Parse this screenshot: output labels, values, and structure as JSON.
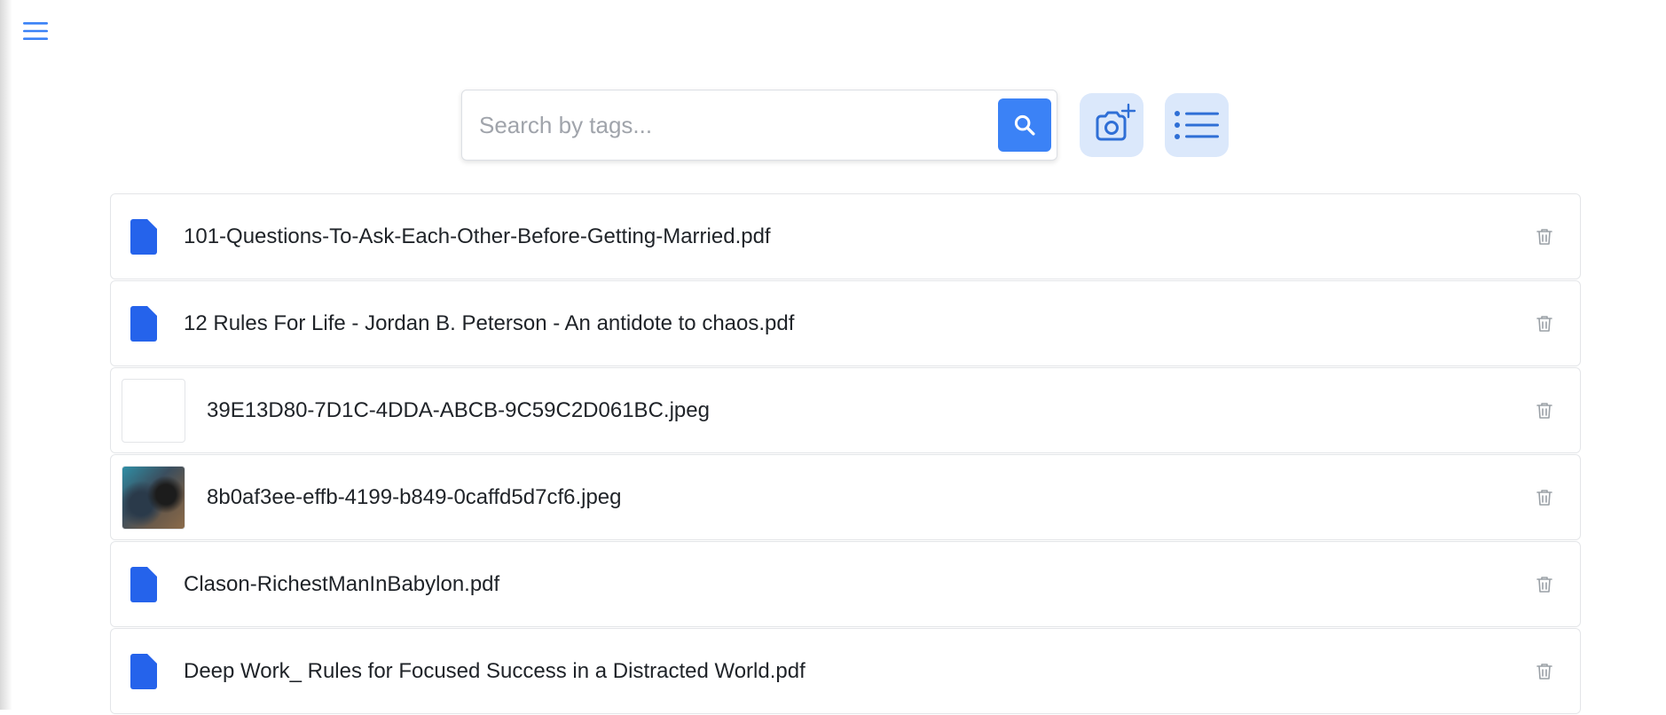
{
  "search": {
    "placeholder": "Search by tags..."
  },
  "toolbar": {
    "search_icon": "search-icon",
    "camera_icon": "camera-plus-icon",
    "list_icon": "list-icon"
  },
  "colors": {
    "accent": "#3b82f6",
    "file_icon": "#2563eb",
    "tool_button_bg": "#dbe8fb"
  },
  "files": [
    {
      "name": "101-Questions-To-Ask-Each-Other-Before-Getting-Married.pdf",
      "type": "pdf"
    },
    {
      "name": "12 Rules For Life - Jordan B. Peterson - An antidote to chaos.pdf",
      "type": "pdf"
    },
    {
      "name": "39E13D80-7D1C-4DDA-ABCB-9C59C2D061BC.jpeg",
      "type": "image-blank"
    },
    {
      "name": "8b0af3ee-effb-4199-b849-0caffd5d7cf6.jpeg",
      "type": "image-photo"
    },
    {
      "name": "Clason-RichestManInBabylon.pdf",
      "type": "pdf"
    },
    {
      "name": "Deep Work_ Rules for Focused Success in a Distracted World.pdf",
      "type": "pdf"
    }
  ]
}
